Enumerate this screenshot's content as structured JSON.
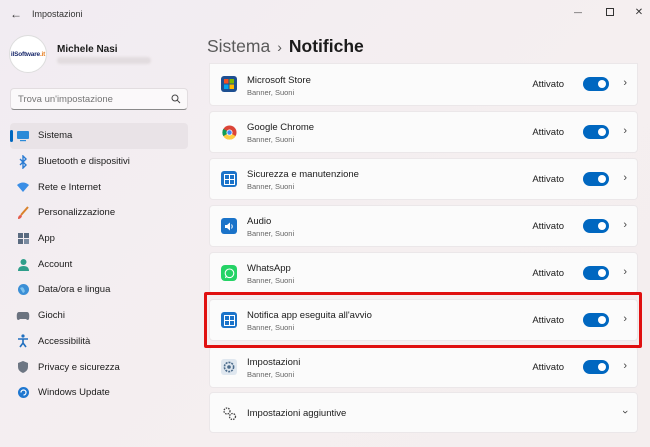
{
  "window": {
    "title": "Impostazioni",
    "back_glyph": "←",
    "min_glyph": "—",
    "close_glyph": "✕"
  },
  "profile": {
    "name": "Michele Nasi",
    "logo_text": "ilSoftware",
    "logo_suffix": ".it"
  },
  "search": {
    "placeholder": "Trova un'impostazione"
  },
  "sidebar": {
    "items": [
      {
        "label": "Sistema",
        "icon": "monitor-icon",
        "active": true
      },
      {
        "label": "Bluetooth e dispositivi",
        "icon": "bluetooth-icon"
      },
      {
        "label": "Rete e Internet",
        "icon": "wifi-icon"
      },
      {
        "label": "Personalizzazione",
        "icon": "brush-icon"
      },
      {
        "label": "App",
        "icon": "apps-icon"
      },
      {
        "label": "Account",
        "icon": "person-icon"
      },
      {
        "label": "Data/ora e lingua",
        "icon": "globe-clock-icon"
      },
      {
        "label": "Giochi",
        "icon": "gamepad-icon"
      },
      {
        "label": "Accessibilità",
        "icon": "accessibility-icon"
      },
      {
        "label": "Privacy e sicurezza",
        "icon": "shield-icon"
      },
      {
        "label": "Windows Update",
        "icon": "update-icon"
      }
    ]
  },
  "header": {
    "parent": "Sistema",
    "separator": "›",
    "current": "Notifiche"
  },
  "notifications": [
    {
      "title": "Microsoft Store",
      "subtitle": "Banner, Suoni",
      "state": "Attivato",
      "enabled": true,
      "icon": "store-icon"
    },
    {
      "title": "Google Chrome",
      "subtitle": "Banner, Suoni",
      "state": "Attivato",
      "enabled": true,
      "icon": "chrome-icon"
    },
    {
      "title": "Sicurezza e manutenzione",
      "subtitle": "Banner, Suoni",
      "state": "Attivato",
      "enabled": true,
      "icon": "security-maintenance-icon"
    },
    {
      "title": "Audio",
      "subtitle": "Banner, Suoni",
      "state": "Attivato",
      "enabled": true,
      "icon": "audio-icon"
    },
    {
      "title": "WhatsApp",
      "subtitle": "Banner, Suoni",
      "state": "Attivato",
      "enabled": true,
      "icon": "whatsapp-icon"
    },
    {
      "title": "Notifica app eseguita all'avvio",
      "subtitle": "Banner, Suoni",
      "state": "Attivato",
      "enabled": true,
      "icon": "startup-app-icon"
    },
    {
      "title": "Impostazioni",
      "subtitle": "Banner, Suoni",
      "state": "Attivato",
      "enabled": true,
      "icon": "settings-app-icon"
    }
  ],
  "additional": {
    "label": "Impostazioni aggiuntive"
  },
  "colors": {
    "accent": "#0067c0",
    "highlight": "#e01010"
  }
}
